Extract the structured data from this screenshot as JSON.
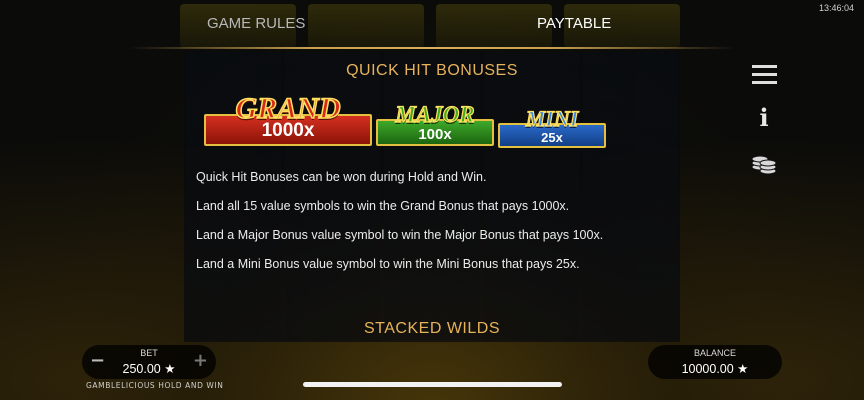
{
  "status_bar": {
    "time": "13:46:04"
  },
  "tabs": [
    {
      "label": "GAME RULES",
      "active": false
    },
    {
      "label": "PAYTABLE",
      "active": true
    }
  ],
  "paytable": {
    "quick_hit": {
      "title": "QUICK HIT BONUSES",
      "jackpots": [
        {
          "name": "GRAND",
          "value": "1000x",
          "color": "#d42a18"
        },
        {
          "name": "MAJOR",
          "value": "100x",
          "color": "#3eaa22"
        },
        {
          "name": "MINI",
          "value": "25x",
          "color": "#3a86e0"
        }
      ],
      "lines": [
        "Quick Hit Bonuses can be won during Hold and Win.",
        "Land all 15 value symbols to win the Grand Bonus that pays 1000x.",
        "Land a Major Bonus value symbol to win the Major Bonus that pays 100x.",
        "Land a Mini Bonus value symbol to win the Mini Bonus that pays 25x."
      ]
    },
    "stacked_wilds": {
      "title": "STACKED WILDS"
    }
  },
  "side_icons": [
    "menu-icon",
    "info-icon",
    "coins-icon"
  ],
  "bet": {
    "label": "BET",
    "value": "250.00 ★",
    "minus": "−",
    "plus": "+"
  },
  "balance": {
    "label": "BALANCE",
    "value": "10000.00 ★"
  },
  "game_name": "GAMBLELICIOUS HOLD AND WIN",
  "colors": {
    "accent_gold": "#e6b35a",
    "divider": "#c8a050"
  }
}
